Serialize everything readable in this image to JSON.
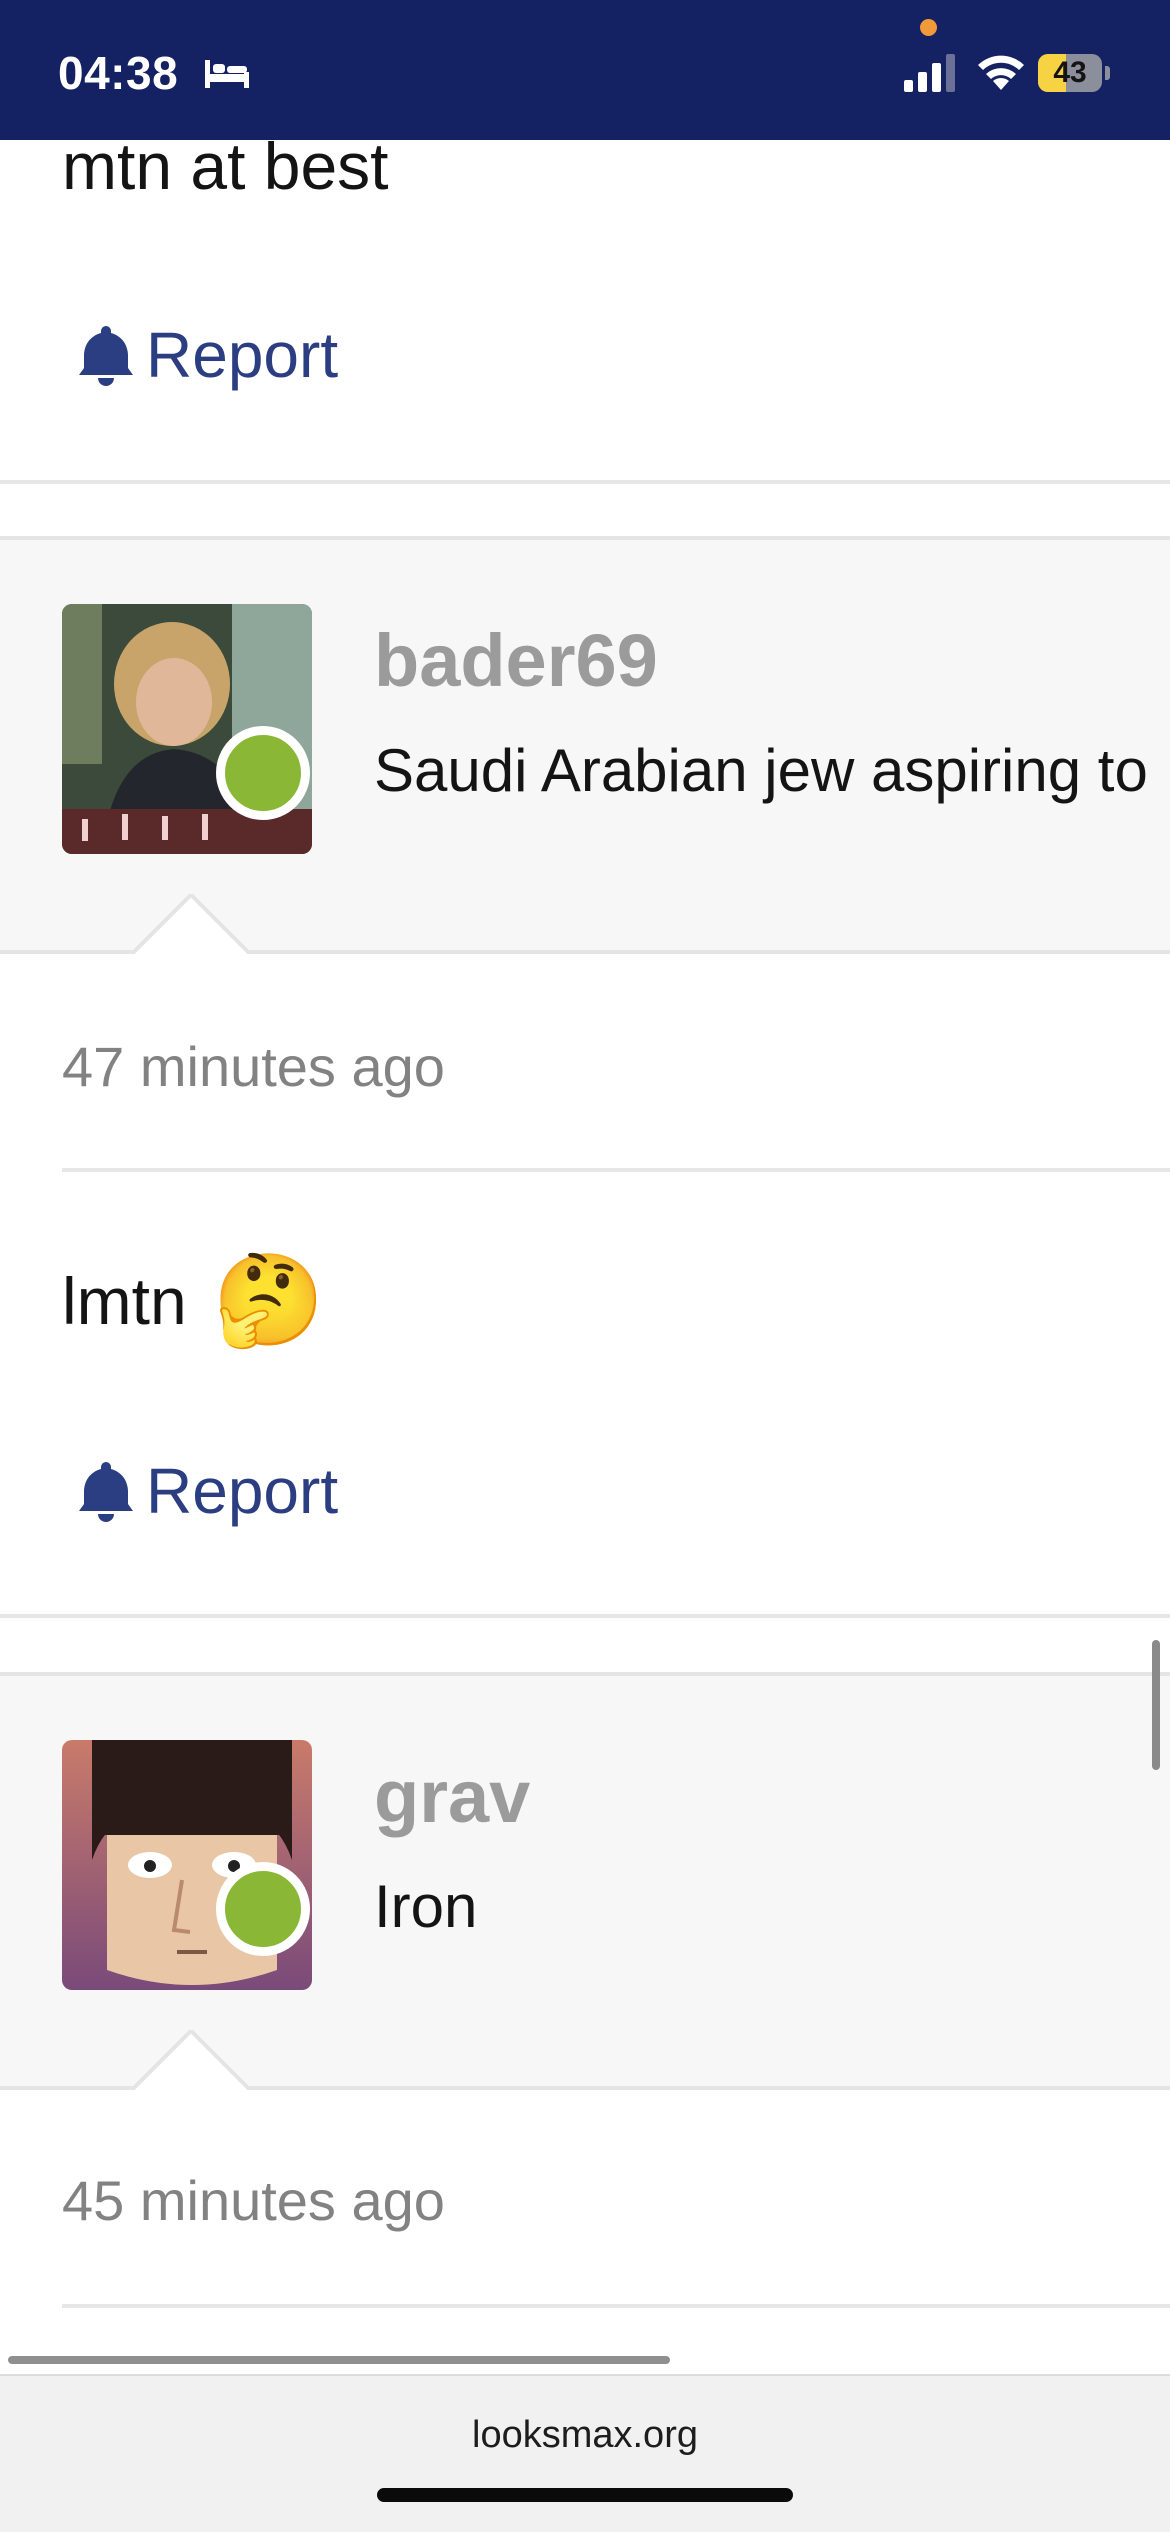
{
  "status_bar": {
    "time": "04:38",
    "battery": "43",
    "battery_level": 0.43
  },
  "posts": [
    {
      "body_text": "mtn at best",
      "report_label": "Report"
    },
    {
      "username": "bader69",
      "user_title": "Saudi Arabian jew aspiring to",
      "online": true,
      "timestamp": "47 minutes ago",
      "body_text": "lmtn",
      "body_emoji": "🤔",
      "report_label": "Report"
    },
    {
      "username": "grav",
      "user_title": "Iron",
      "online": true,
      "timestamp": "45 minutes ago"
    }
  ],
  "browser": {
    "url": "looksmax.org"
  },
  "colors": {
    "status_bar_bg": "#142162",
    "link": "#2c3e82",
    "online": "#8ab836",
    "username": "#9b9b9b"
  }
}
